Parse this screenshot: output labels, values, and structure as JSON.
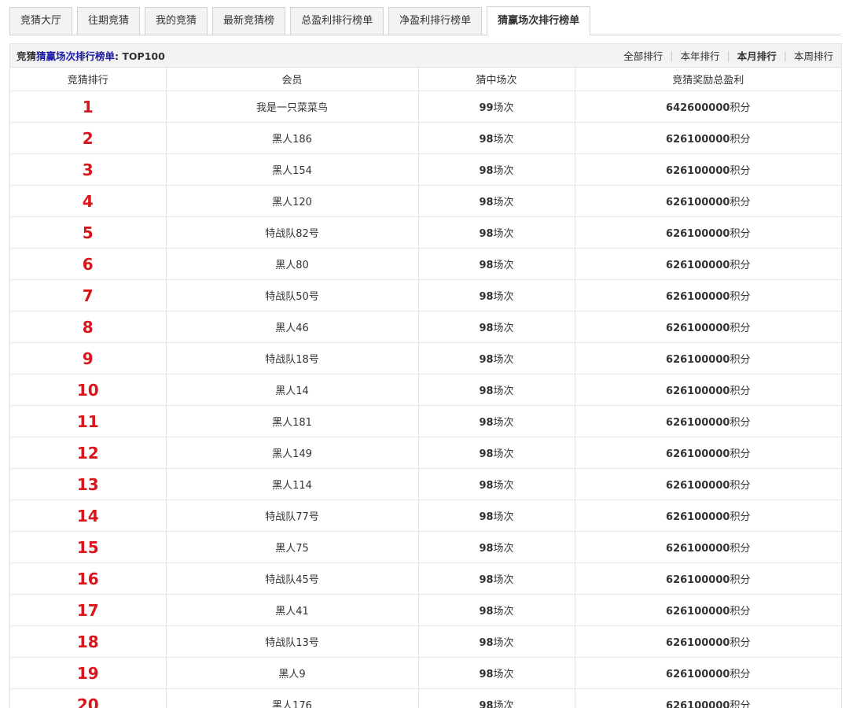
{
  "tabs": [
    {
      "label": "竞猜大厅",
      "active": false
    },
    {
      "label": "往期竞猜",
      "active": false
    },
    {
      "label": "我的竞猜",
      "active": false
    },
    {
      "label": "最新竞猜榜",
      "active": false
    },
    {
      "label": "总盈利排行榜单",
      "active": false
    },
    {
      "label": "净盈利排行榜单",
      "active": false
    },
    {
      "label": "猜赢场次排行榜单",
      "active": true
    }
  ],
  "panel": {
    "title_prefix": "竞猜",
    "title_highlight": "猜赢场次排行榜单",
    "title_suffix": ": TOP100",
    "filters": [
      {
        "label": "全部排行",
        "active": false
      },
      {
        "label": "本年排行",
        "active": false
      },
      {
        "label": "本月排行",
        "active": true
      },
      {
        "label": "本周排行",
        "active": false
      }
    ],
    "filter_separator": "|"
  },
  "table": {
    "columns": [
      "竞猜排行",
      "会员",
      "猜中场次",
      "竞猜奖励总盈利"
    ],
    "hits_unit": "场次",
    "profit_unit": "积分",
    "rows": [
      {
        "rank": "1",
        "member": "我是一只菜菜鸟",
        "hits": "99",
        "profit": "642600000"
      },
      {
        "rank": "2",
        "member": "黑人186",
        "hits": "98",
        "profit": "626100000"
      },
      {
        "rank": "3",
        "member": "黑人154",
        "hits": "98",
        "profit": "626100000"
      },
      {
        "rank": "4",
        "member": "黑人120",
        "hits": "98",
        "profit": "626100000"
      },
      {
        "rank": "5",
        "member": "特战队82号",
        "hits": "98",
        "profit": "626100000"
      },
      {
        "rank": "6",
        "member": "黑人80",
        "hits": "98",
        "profit": "626100000"
      },
      {
        "rank": "7",
        "member": "特战队50号",
        "hits": "98",
        "profit": "626100000"
      },
      {
        "rank": "8",
        "member": "黑人46",
        "hits": "98",
        "profit": "626100000"
      },
      {
        "rank": "9",
        "member": "特战队18号",
        "hits": "98",
        "profit": "626100000"
      },
      {
        "rank": "10",
        "member": "黑人14",
        "hits": "98",
        "profit": "626100000"
      },
      {
        "rank": "11",
        "member": "黑人181",
        "hits": "98",
        "profit": "626100000"
      },
      {
        "rank": "12",
        "member": "黑人149",
        "hits": "98",
        "profit": "626100000"
      },
      {
        "rank": "13",
        "member": "黑人114",
        "hits": "98",
        "profit": "626100000"
      },
      {
        "rank": "14",
        "member": "特战队77号",
        "hits": "98",
        "profit": "626100000"
      },
      {
        "rank": "15",
        "member": "黑人75",
        "hits": "98",
        "profit": "626100000"
      },
      {
        "rank": "16",
        "member": "特战队45号",
        "hits": "98",
        "profit": "626100000"
      },
      {
        "rank": "17",
        "member": "黑人41",
        "hits": "98",
        "profit": "626100000"
      },
      {
        "rank": "18",
        "member": "特战队13号",
        "hits": "98",
        "profit": "626100000"
      },
      {
        "rank": "19",
        "member": "黑人9",
        "hits": "98",
        "profit": "626100000"
      },
      {
        "rank": "20",
        "member": "黑人176",
        "hits": "98",
        "profit": "626100000"
      }
    ]
  },
  "colors": {
    "rank": "#d8161b",
    "title_highlight": "#1a1aa6",
    "header_bg": "#f3f3f3",
    "border": "#e6e6e6"
  }
}
